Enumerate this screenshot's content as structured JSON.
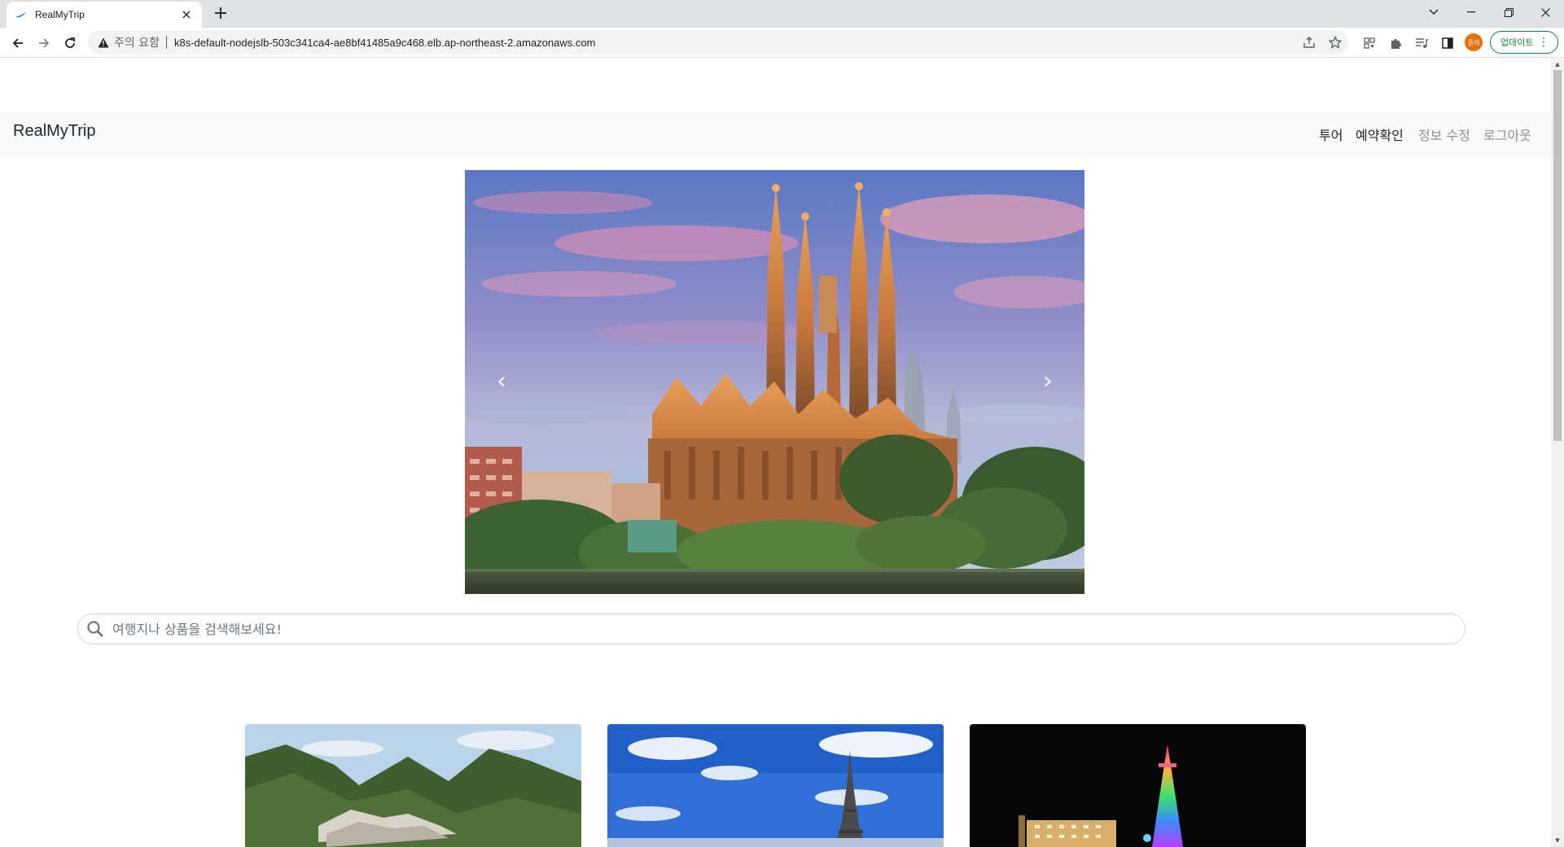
{
  "browser": {
    "tab_title": "RealMyTrip",
    "warning_label": "주의 요함",
    "url": "k8s-default-nodejslb-503c341ca4-ae8bf41485a9c468.elb.ap-northeast-2.amazonaws.com",
    "profile_label": "종석",
    "update_label": "업데이트"
  },
  "page": {
    "brand": "RealMyTrip",
    "nav": [
      {
        "label": "투어",
        "active": true
      },
      {
        "label": "예약확인",
        "active": true
      },
      {
        "label": "정보 수정",
        "active": false
      },
      {
        "label": "로그아웃",
        "active": false
      }
    ],
    "carousel": {
      "prev_label": "‹",
      "next_label": "›"
    },
    "search": {
      "placeholder": "여행지나 상품을 검색해보세요!"
    }
  },
  "colors": {
    "navbar_bg": "#f8f9fa",
    "nav_active": "#212529",
    "nav_muted": "#8c8f93",
    "update_green": "#188038",
    "profile_orange": "#e8710a"
  }
}
